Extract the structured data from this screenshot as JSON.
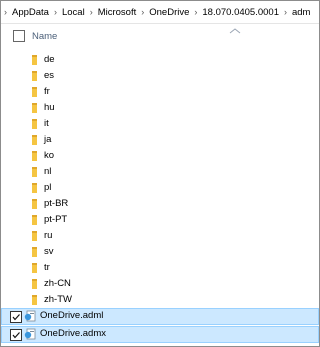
{
  "breadcrumb": [
    "AppData",
    "Local",
    "Microsoft",
    "OneDrive",
    "18.070.0405.0001",
    "adm"
  ],
  "header": {
    "name_label": "Name"
  },
  "folders": [
    "de",
    "es",
    "fr",
    "hu",
    "it",
    "ja",
    "ko",
    "nl",
    "pl",
    "pt-BR",
    "pt-PT",
    "ru",
    "sv",
    "tr",
    "zh-CN",
    "zh-TW"
  ],
  "files": [
    {
      "name": "OneDrive.adml",
      "selected": true,
      "checked": true
    },
    {
      "name": "OneDrive.admx",
      "selected": true,
      "checked": true
    }
  ],
  "colors": {
    "folder": "#f5c542",
    "selection_bg": "#cce8ff",
    "selection_border": "#99d1ff",
    "header_text": "#4c607a"
  },
  "icons": {
    "breadcrumb_separator": "chevron-right-icon",
    "folder": "folder-icon",
    "file": "admin-template-file-icon",
    "sort": "sort-up-arrow-icon"
  }
}
